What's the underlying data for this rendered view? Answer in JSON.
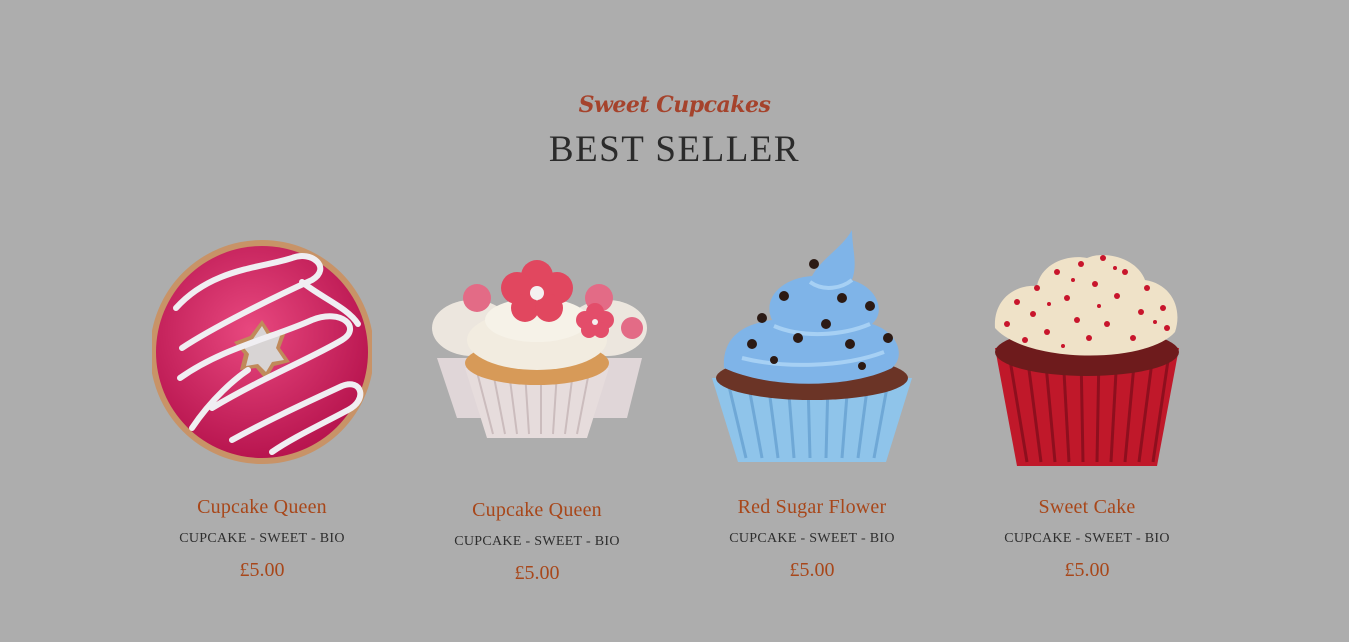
{
  "section": {
    "subtitle": "Sweet Cupcakes",
    "title": "BEST SELLER"
  },
  "colors": {
    "background": "#adadad",
    "accent": "#a8471a",
    "subtitle": "#a5432c",
    "title": "#2b2b2b"
  },
  "products": [
    {
      "name": "Cupcake Queen",
      "tags": "CUPCAKE - SWEET - BIO",
      "price": "£5.00",
      "image_icon": "pink-donut-icon"
    },
    {
      "name": "Cupcake Queen",
      "tags": "CUPCAKE - SWEET - BIO",
      "price": "£5.00",
      "image_icon": "flower-cupcakes-icon"
    },
    {
      "name": "Red Sugar Flower",
      "tags": "CUPCAKE - SWEET - BIO",
      "price": "£5.00",
      "image_icon": "blue-cupcake-icon"
    },
    {
      "name": "Sweet Cake",
      "tags": "CUPCAKE - SWEET - BIO",
      "price": "£5.00",
      "image_icon": "red-velvet-cupcake-icon"
    }
  ]
}
